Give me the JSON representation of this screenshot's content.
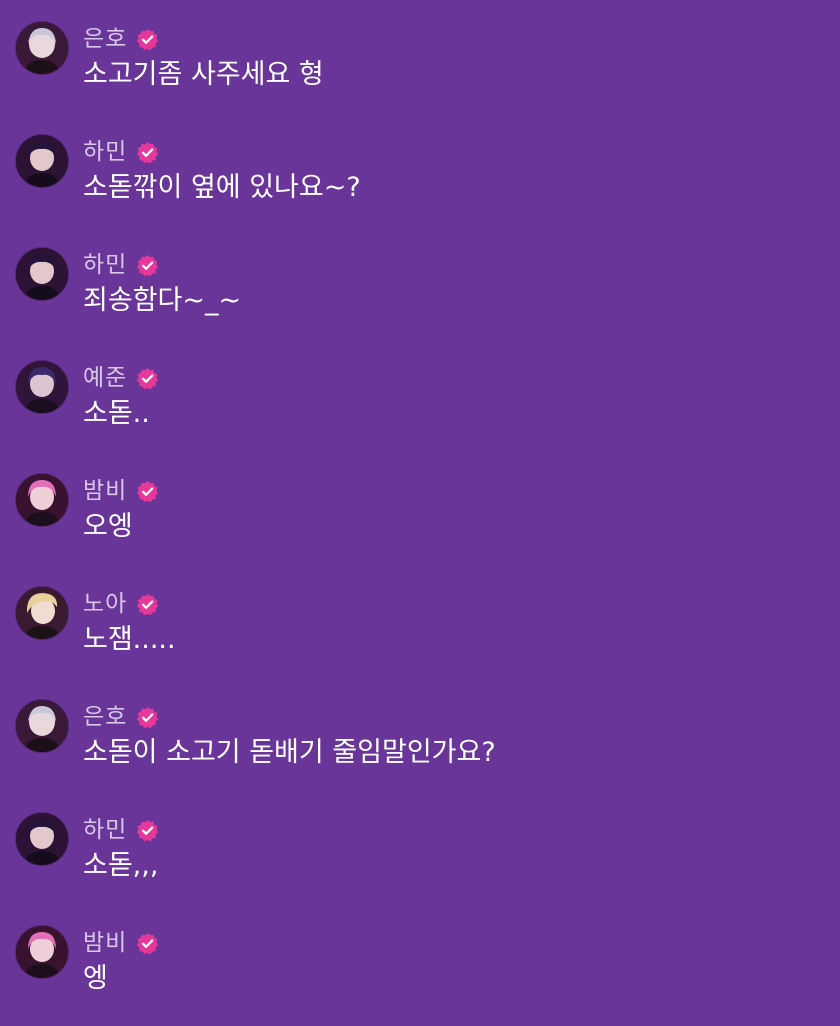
{
  "messages": [
    {
      "user": "은호",
      "text": "소고기좀 사주세요 형",
      "avatar": "avatar-eunho",
      "verified_icon": "verified-badge-icon"
    },
    {
      "user": "하민",
      "text": "소돋깎이 옆에 있나요~?",
      "avatar": "avatar-hamin",
      "verified_icon": "verified-badge-icon"
    },
    {
      "user": "하민",
      "text": "죄송함다~_~",
      "avatar": "avatar-hamin",
      "verified_icon": "verified-badge-icon"
    },
    {
      "user": "예준",
      "text": "소돋..",
      "avatar": "avatar-yejun",
      "verified_icon": "verified-badge-icon"
    },
    {
      "user": "밤비",
      "text": "오엥",
      "avatar": "avatar-bambi",
      "verified_icon": "verified-badge-icon"
    },
    {
      "user": "노아",
      "text": "노잼.....",
      "avatar": "avatar-noah",
      "verified_icon": "verified-badge-icon"
    },
    {
      "user": "은호",
      "text": "소돋이 소고기 돋배기 줄임말인가요?",
      "avatar": "avatar-eunho",
      "verified_icon": "verified-badge-icon"
    },
    {
      "user": "하민",
      "text": "소돋,,,",
      "avatar": "avatar-hamin",
      "verified_icon": "verified-badge-icon"
    },
    {
      "user": "밤비",
      "text": "엥",
      "avatar": "avatar-bambi",
      "verified_icon": "verified-badge-icon"
    }
  ],
  "colors": {
    "background": "#6a3598",
    "username": "#d8c8e8",
    "message_text": "#ffffff",
    "verified_badge": "#e6389a"
  }
}
